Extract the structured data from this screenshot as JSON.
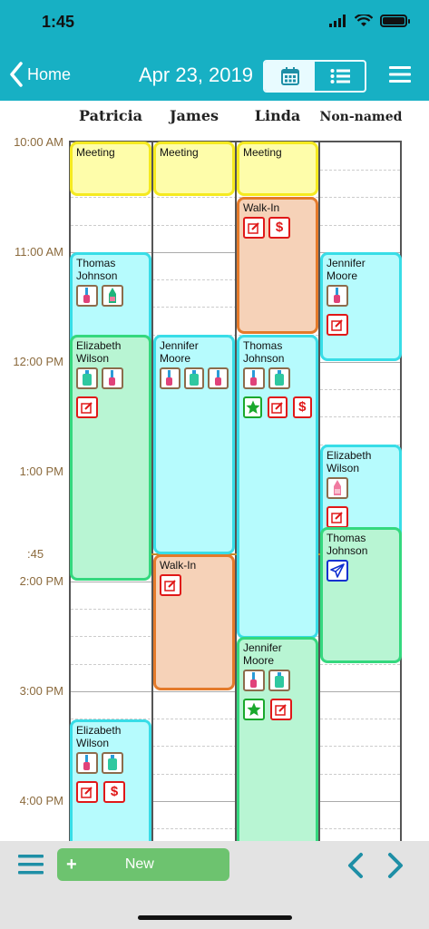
{
  "status": {
    "time": "1:45"
  },
  "header": {
    "back_label": "Home",
    "date": "Apr 23, 2019"
  },
  "columns": [
    "Patricia",
    "James",
    "Linda",
    "Non-named"
  ],
  "time_labels": [
    "10:00 AM",
    "11:00 AM",
    "12:00 PM",
    "1:00 PM",
    "2:00 PM",
    "3:00 PM",
    "4:00 PM"
  ],
  "now_marker": ":45",
  "appointments": [
    {
      "title": "Meeting",
      "col": 0,
      "type": "meeting"
    },
    {
      "title": "Meeting",
      "col": 1,
      "type": "meeting"
    },
    {
      "title": "Meeting",
      "col": 2,
      "type": "meeting"
    },
    {
      "title": "Walk-In",
      "col": 2,
      "type": "walk-in"
    },
    {
      "title": "Thomas Johnson",
      "col": 0,
      "type": "client"
    },
    {
      "title": "Jennifer Moore",
      "col": 3,
      "type": "client"
    },
    {
      "title": "Elizabeth Wilson",
      "col": 0,
      "type": "client"
    },
    {
      "title": "Jennifer Moore",
      "col": 1,
      "type": "client"
    },
    {
      "title": "Thomas Johnson",
      "col": 2,
      "type": "client"
    },
    {
      "title": "Elizabeth Wilson",
      "col": 3,
      "type": "client"
    },
    {
      "title": "Thomas Johnson",
      "col": 3,
      "type": "client"
    },
    {
      "title": "Walk-In",
      "col": 1,
      "type": "walk-in"
    },
    {
      "title": "Jennifer Moore",
      "col": 2,
      "type": "client"
    },
    {
      "title": "Elizabeth Wilson",
      "col": 0,
      "type": "client"
    }
  ],
  "toolbar": {
    "new_plus": "+",
    "new_label": "New"
  },
  "colors": {
    "header": "#17b0c4",
    "meeting": "#fefdaa",
    "walk_in": "#f6d2b8",
    "booked": "#b6fbfd",
    "confirmed": "#b8f5d3",
    "new_button": "#6dc36f",
    "accent": "#1e8fa6"
  },
  "icons": [
    "home-chevron-icon",
    "calendar-icon",
    "list-icon",
    "menu-icon",
    "edit-icon",
    "dollar-icon",
    "star-icon",
    "send-icon",
    "nail-polish-icon",
    "lotion-bottle-icon",
    "chevron-left-icon",
    "chevron-right-icon"
  ]
}
